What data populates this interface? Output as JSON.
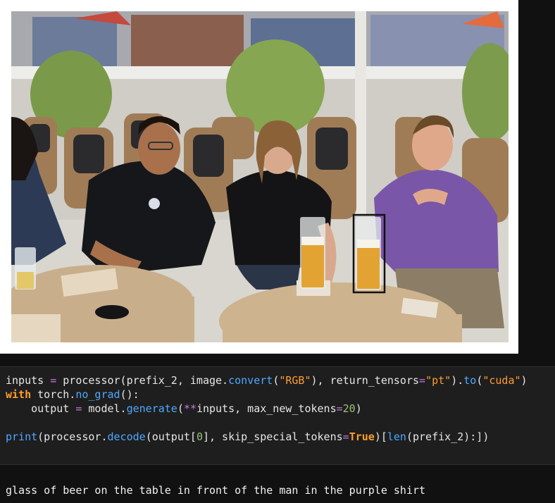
{
  "code": {
    "line1": {
      "a": "inputs ",
      "eq": "=",
      "b": " processor(prefix_2, image.",
      "convert": "convert",
      "c": "(",
      "rgb": "\"RGB\"",
      "d": "), return_tensors",
      "eq2": "=",
      "pt": "\"pt\"",
      "e": ").",
      "to": "to",
      "f": "(",
      "cuda": "\"cuda\"",
      "g": ")"
    },
    "line2": {
      "with": "with",
      "a": " torch.",
      "no_grad": "no_grad",
      "b": "():"
    },
    "line3": {
      "a": "    output ",
      "eq": "=",
      "b": " model.",
      "generate": "generate",
      "c": "(",
      "star": "**",
      "d": "inputs, max_new_tokens",
      "eq2": "=",
      "n": "20",
      "e": ")"
    },
    "line5": {
      "print": "print",
      "a": "(processor.",
      "decode": "decode",
      "b": "(output[",
      "zero": "0",
      "c": "], skip_special_tokens",
      "eq": "=",
      "true": "True",
      "d": ")[",
      "len": "len",
      "e": "(prefix_2):])"
    }
  },
  "output": {
    "text": "glass of beer on the table in front of the man in the purple shirt"
  },
  "colors": {
    "background": "#111111",
    "code_bg": "#1e1e1e",
    "keyword": "#ff9d2e",
    "function": "#4fa8ff",
    "operator": "#c678dd",
    "bbox": "#111111"
  }
}
